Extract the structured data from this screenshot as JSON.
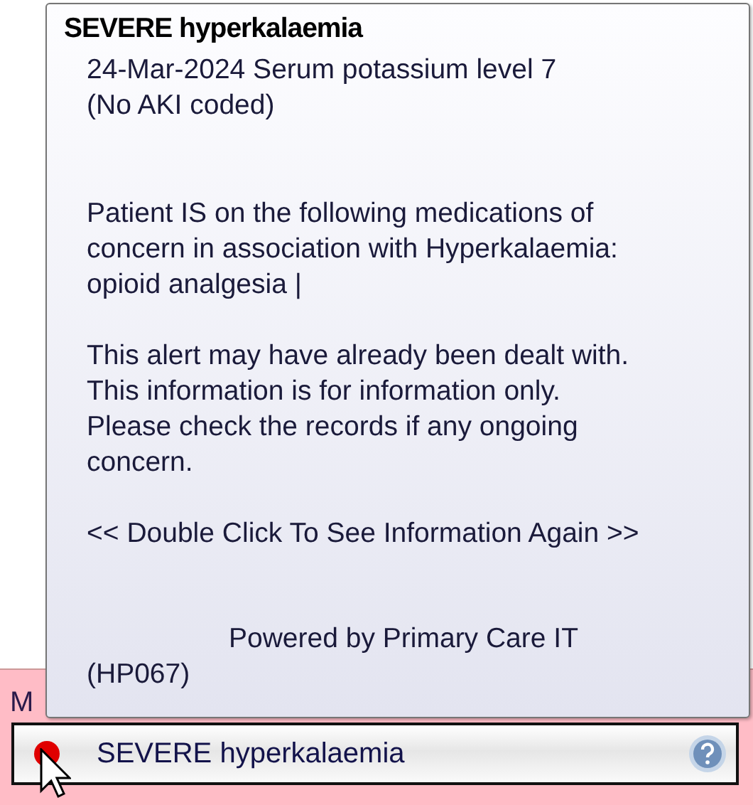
{
  "tooltip": {
    "title": "SEVERE hyperkalaemia",
    "paragraphs": [
      {
        "lines": [
          "24-Mar-2024 Serum potassium level 7",
          "(No AKI coded)"
        ]
      },
      {
        "lines": [
          "Patient IS on the following medications of",
          "concern in association with Hyperkalaemia:",
          "opioid analgesia |"
        ]
      },
      {
        "lines": [
          "This alert may have already been dealt with.",
          "This information is for information only.",
          "Please check the records if any ongoing",
          "concern."
        ]
      },
      {
        "lines": [
          "<< Double Click To See Information Again >>"
        ]
      }
    ],
    "footer": {
      "lines": [
        "Powered by Primary Care IT",
        "(HP067)"
      ]
    }
  },
  "panel": {
    "label": "M",
    "alert": {
      "text": "SEVERE hyperkalaemia",
      "color": "#e00000"
    }
  }
}
